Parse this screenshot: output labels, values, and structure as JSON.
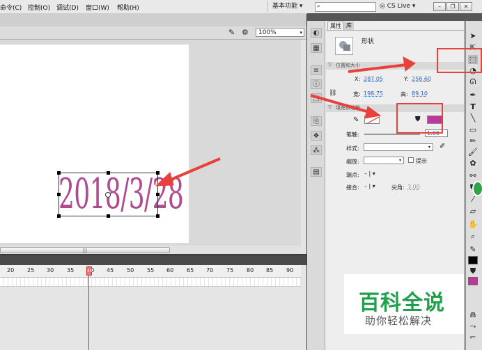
{
  "menu": {
    "items": [
      "命令(C)",
      "控制(O)",
      "调试(D)",
      "窗口(W)",
      "帮助(H)"
    ],
    "workspace": "基本功能",
    "cs_live": "CS Live",
    "zoom": "100%"
  },
  "stage": {
    "text": "2018/3/28",
    "text_color": "#b04a8f"
  },
  "timeline": {
    "ticks": [
      "20",
      "25",
      "30",
      "35",
      "40",
      "45",
      "50",
      "55",
      "60",
      "65",
      "70",
      "75",
      "80",
      "85",
      "90"
    ],
    "current_frame": "40"
  },
  "properties": {
    "tabs": [
      "属性",
      "库"
    ],
    "object_type": "形状",
    "section_position": "位置和大小",
    "x_label": "X:",
    "x_value": "287.05",
    "y_label": "Y:",
    "y_value": "258.60",
    "width_label": "宽:",
    "width_value": "198.75",
    "height_label": "高:",
    "height_value": "89.10",
    "section_fill": "填充和笔触",
    "fill_color": "#c0359e",
    "stroke_label": "笔触:",
    "stroke_value": "1.00",
    "style_label": "样式:",
    "scale_label": "缩放:",
    "hint_label": "提示",
    "cap_label": "端点:",
    "join_label": "接合:",
    "miter_label": "尖角:",
    "miter_value": "3.00"
  },
  "watermark": {
    "title": "百科全说",
    "subtitle": "助你轻松解决"
  },
  "colors": {
    "annotation_red": "#e8403a"
  }
}
